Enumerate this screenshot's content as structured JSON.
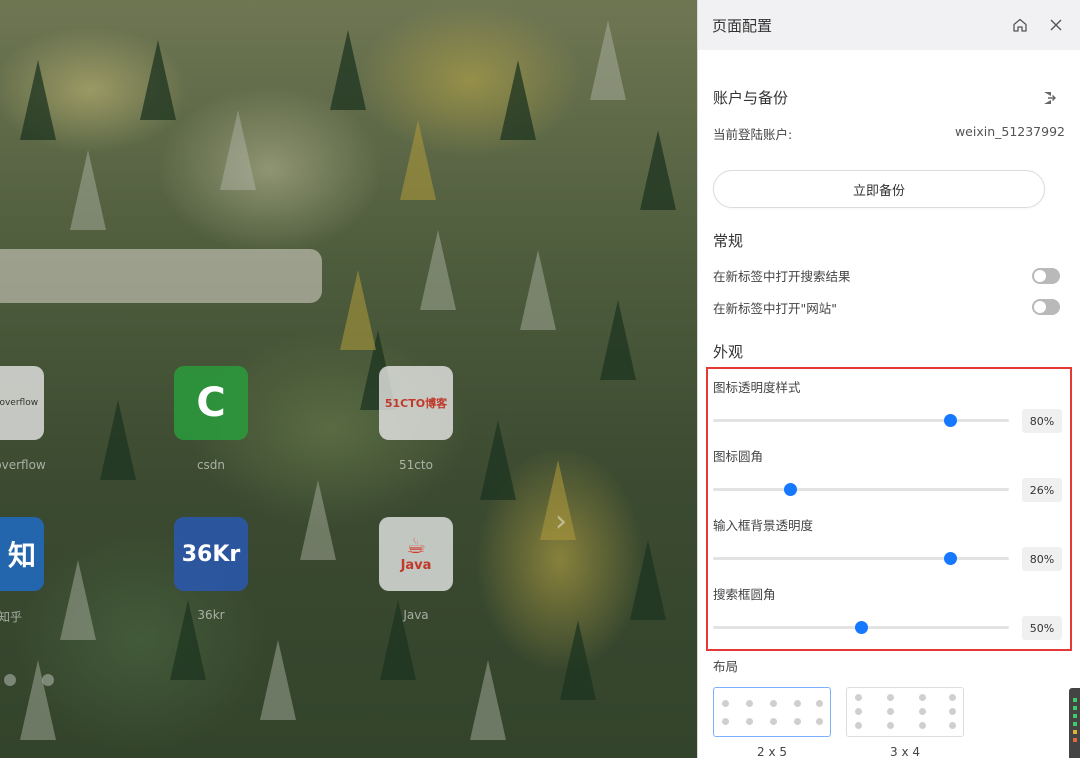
{
  "panel": {
    "title": "页面配置",
    "account_section": {
      "title": "账户与备份",
      "current_account_label": "当前登陆账户:",
      "current_account_value": "weixin_51237992",
      "backup_button": "立即备份"
    },
    "general_section": {
      "title": "常规",
      "toggles": [
        {
          "label": "在新标签中打开搜索结果",
          "on": false
        },
        {
          "label": "在新标签中打开\"网站\"",
          "on": false
        }
      ]
    },
    "appearance_section": {
      "title": "外观",
      "sliders": [
        {
          "label": "图标透明度样式",
          "value": 80,
          "display": "80%"
        },
        {
          "label": "图标圆角",
          "value": 26,
          "display": "26%"
        },
        {
          "label": "输入框背景透明度",
          "value": 80,
          "display": "80%"
        },
        {
          "label": "搜索框圆角",
          "value": 50,
          "display": "50%"
        }
      ]
    },
    "layout_section": {
      "title": "布局",
      "options": [
        {
          "caption": "2 x 5",
          "selected": true
        },
        {
          "caption": "3 x 4",
          "selected": false
        }
      ]
    }
  },
  "desktop": {
    "tiles": [
      {
        "label": "overflow",
        "logo_text": "stackoverflow"
      },
      {
        "label": "csdn",
        "logo_text": "C"
      },
      {
        "label": "51cto",
        "logo_text": "51CTO博客"
      },
      {
        "label": "知乎",
        "logo_text": "知"
      },
      {
        "label": "36kr",
        "logo_text": "36Kr"
      },
      {
        "label": "Java",
        "logo_text": "Java"
      }
    ]
  },
  "colors": {
    "accent": "#1677ff",
    "highlight_border": "#e53935",
    "toggle_off": "#b9b9b9"
  },
  "icons": {
    "home": "home-icon",
    "close": "close-icon",
    "logout": "logout-icon",
    "next": "chevron-right-icon"
  }
}
